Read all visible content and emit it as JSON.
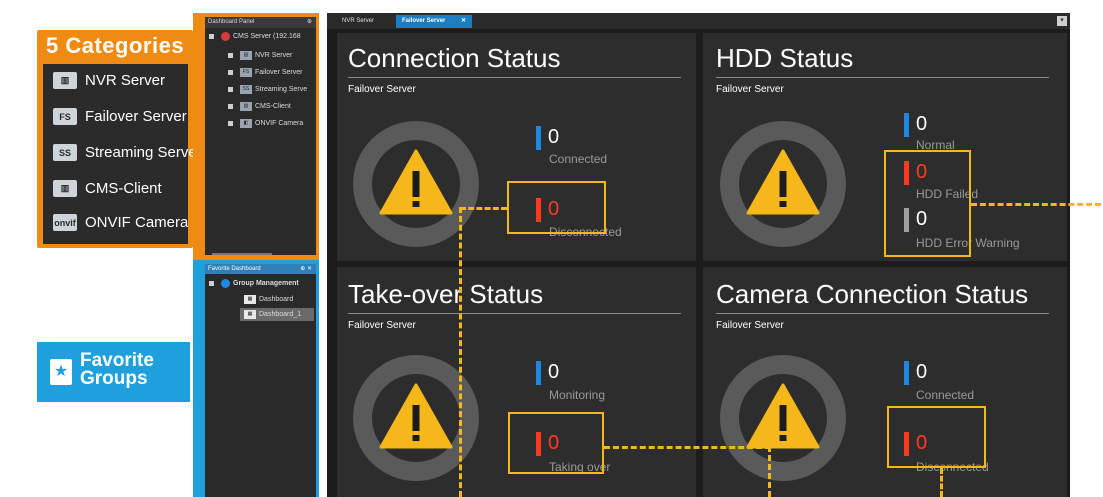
{
  "callout": {
    "title": "5 Categories",
    "items": [
      {
        "label": "NVR Server",
        "icon": "nvr-server-icon",
        "badge": ""
      },
      {
        "label": "Failover Server",
        "icon": "failover-server-icon",
        "badge": "FS"
      },
      {
        "label": "Streaming Server",
        "icon": "streaming-server-icon",
        "badge": "SS"
      },
      {
        "label": "CMS-Client",
        "icon": "cms-client-icon",
        "badge": ""
      },
      {
        "label": "ONVIF Camera",
        "icon": "onvif-camera-icon",
        "badge": "onvif"
      }
    ],
    "favorite_line1": "Favorite",
    "favorite_line2": "Groups"
  },
  "dashboard_panel": {
    "title": "Dashboard Panel",
    "pin": "⊕",
    "root": "CMS Server (192.168",
    "nodes": [
      "NVR Server",
      "Failover Server",
      "Streaming Serve",
      "CMS-Client",
      "ONVIF Camera"
    ]
  },
  "favorite_dashboard": {
    "title": "Favorite Dashboard",
    "controls": "⊕ ✕",
    "root": "Group Management",
    "items": [
      "Dashboard",
      "Dashboard_1"
    ]
  },
  "tabs": {
    "items": [
      "NVR Server",
      "Failover Server"
    ],
    "close": "✕",
    "menu": "▾"
  },
  "quadrants": {
    "connection": {
      "title": "Connection Status",
      "subtitle": "Failover Server",
      "stats": [
        {
          "value": "0",
          "label": "Connected",
          "color": "#1e88e5"
        },
        {
          "value": "0",
          "label": "Disconnected",
          "color": "#ff3b1f"
        }
      ]
    },
    "hdd": {
      "title": "HDD Status",
      "subtitle": "Failover Server",
      "stats": [
        {
          "value": "0",
          "label": "Normal",
          "color": "#1e88e5"
        },
        {
          "value": "0",
          "label": "HDD Failed",
          "color": "#ff3b1f"
        },
        {
          "value": "0",
          "label": "HDD Error Warning",
          "color": "#a0a0a0"
        }
      ]
    },
    "takeover": {
      "title": "Take-over Status",
      "subtitle": "Failover Server",
      "stats": [
        {
          "value": "0",
          "label": "Monitoring",
          "color": "#1e88e5"
        },
        {
          "value": "0",
          "label": "Taking over",
          "color": "#ff3b1f"
        }
      ]
    },
    "camera": {
      "title": "Camera Connection Status",
      "subtitle": "Failover Server",
      "stats": [
        {
          "value": "0",
          "label": "Connected",
          "color": "#1e88e5"
        },
        {
          "value": "0",
          "label": "Disconnected",
          "color": "#ff3b1f"
        }
      ]
    }
  },
  "colors": {
    "accent_orange": "#ef8a12",
    "accent_blue": "#1fa0dd",
    "highlight": "#f5b71a",
    "warning": "#f5b71a"
  }
}
